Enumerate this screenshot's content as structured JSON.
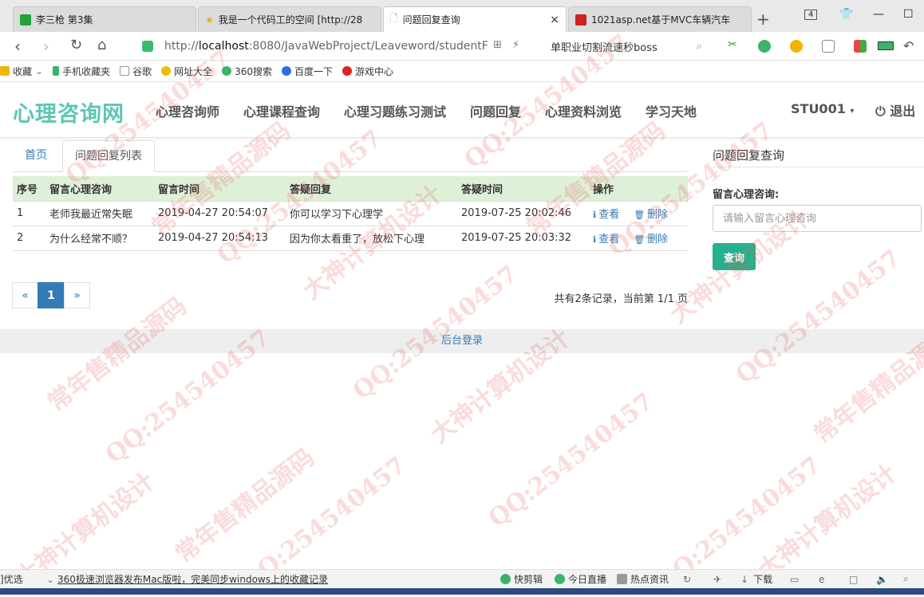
{
  "browser": {
    "tabs": [
      {
        "title": "李三枪 第3集",
        "favicon_color": "#22a33a"
      },
      {
        "title": "我是一个代码工的空间 [http://28",
        "favicon_color": "#e8b100"
      },
      {
        "title": "问题回复查询",
        "favicon_color": "#bbbbbb",
        "close": "×"
      },
      {
        "title": "1021asp.net基于MVC车辆汽车",
        "favicon_color": "#cc2222"
      }
    ],
    "new_tab": "+",
    "tab_count": "4",
    "url_scheme": "http://",
    "url_host": "localhost",
    "url_rest": ":8080/JavaWebProject/Leaveword/studentF",
    "search_text": "单职业切割流速秒boss",
    "bookmarks": [
      "收藏",
      "手机收藏夹",
      "谷歌",
      "网址大全",
      "360搜索",
      "百度一下",
      "游戏中心"
    ]
  },
  "site": {
    "brand": "心理咨询网",
    "nav": [
      "心理咨询师",
      "心理课程查询",
      "心理习题练习测试",
      "问题回复",
      "心理资料浏览",
      "学习天地"
    ],
    "user": "STU001",
    "logout": "退出"
  },
  "tabs": {
    "home": "首页",
    "current": "问题回复列表"
  },
  "table": {
    "headers": [
      "序号",
      "留言心理咨询",
      "留言时间",
      "答疑回复",
      "答疑时间",
      "操作"
    ],
    "rows": [
      {
        "no": "1",
        "question": "老师我最近常失眠",
        "q_time": "2019-04-27 20:54:07",
        "reply": "你可以学习下心理学",
        "r_time": "2019-07-25 20:02:46"
      },
      {
        "no": "2",
        "question": "为什么经常不顺？",
        "q_time": "2019-04-27 20:54:13",
        "reply": "因为你太看重了，放松下心理",
        "r_time": "2019-07-25 20:03:32"
      }
    ],
    "view_label": "查看",
    "delete_label": "删除"
  },
  "pager": {
    "prev": "«",
    "current": "1",
    "next": "»",
    "summary": "共有2条记录，当前第 1/1 页"
  },
  "footer": {
    "admin_login": "后台登录"
  },
  "sidebar": {
    "title": "问题回复查询",
    "field_label": "留言心理咨询:",
    "placeholder": "请输入留言心理咨询",
    "query_button": "查询"
  },
  "watermarks": [
    "QQ:254540457",
    "常年售精品源码",
    "大神计算机设计"
  ],
  "statusbar": {
    "left": "]优选",
    "news": "360极速浏览器发布Mac版啦，完美同步windows上的收藏记录",
    "items": [
      "快剪辑",
      "今日直播",
      "热点资讯",
      "下载"
    ]
  },
  "colors": {
    "brand": "#5cc6b5",
    "link": "#337ab7",
    "table_header": "#dff0d8",
    "query_button": "#26b08e"
  }
}
